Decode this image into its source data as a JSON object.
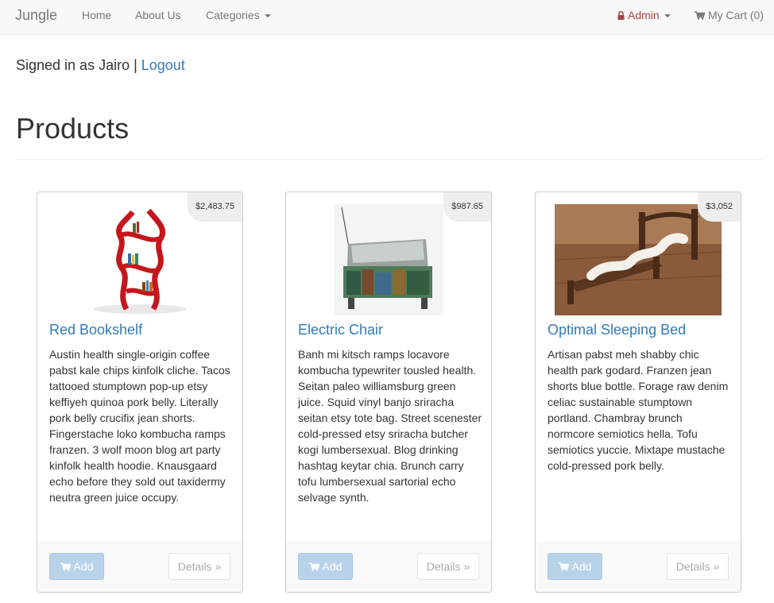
{
  "navbar": {
    "brand": "Jungle",
    "home": "Home",
    "about": "About Us",
    "categories": "Categories",
    "admin": "Admin",
    "cart": "My Cart (0)"
  },
  "session": {
    "signed_in_text": "Signed in as Jairo | ",
    "logout": "Logout"
  },
  "page": {
    "title": "Products"
  },
  "products": [
    {
      "name": "Red Bookshelf",
      "price": "$2,483.75",
      "description": "Austin health single-origin coffee pabst kale chips kinfolk cliche. Tacos tattooed stumptown pop-up etsy keffiyeh quinoa pork belly. Literally pork belly crucifix jean shorts. Fingerstache loko kombucha ramps franzen. 3 wolf moon blog art party kinfolk health hoodie. Knausgaard echo before they sold out taxidermy neutra green juice occupy.",
      "add_label": "Add",
      "details_label": "Details »"
    },
    {
      "name": "Electric Chair",
      "price": "$987.65",
      "description": "Banh mi kitsch ramps locavore kombucha typewriter tousled health. Seitan paleo williamsburg green juice. Squid vinyl banjo sriracha seitan etsy tote bag. Street scenester cold-pressed etsy sriracha butcher kogi lumbersexual. Blog drinking hashtag keytar chia. Brunch carry tofu lumbersexual sartorial echo selvage synth.",
      "add_label": "Add",
      "details_label": "Details »"
    },
    {
      "name": "Optimal Sleeping Bed",
      "price": "$3,052",
      "description": "Artisan pabst meh shabby chic health park godard. Franzen jean shorts blue bottle. Forage raw denim celiac sustainable stumptown portland. Chambray brunch normcore semiotics hella. Tofu semiotics yuccie. Mixtape mustache cold-pressed pork belly.",
      "add_label": "Add",
      "details_label": "Details »"
    }
  ]
}
